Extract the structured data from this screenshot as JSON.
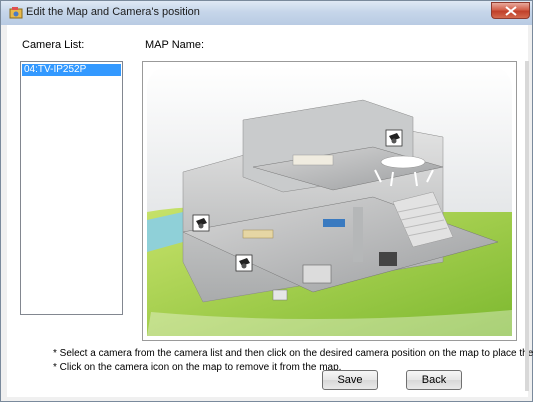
{
  "window": {
    "title": "Edit the Map and Camera's position"
  },
  "labels": {
    "camera_list": "Camera List:",
    "map_name": "MAP Name:"
  },
  "camera_list": {
    "items": [
      "04:TV-IP252P"
    ],
    "selected_index": 0
  },
  "instructions": {
    "line1": "* Select a camera from the camera list and then click on the desired camera position on the map to place the ca",
    "line2": "* Click on the camera icon on the map to remove it from the map."
  },
  "buttons": {
    "save": "Save",
    "back": "Back"
  },
  "colors": {
    "selection": "#3399ff",
    "titlebar": "#c6d6ea",
    "close": "#c0402a"
  },
  "map": {
    "icons": [
      "camera-icon",
      "camera-icon",
      "camera-icon"
    ]
  }
}
